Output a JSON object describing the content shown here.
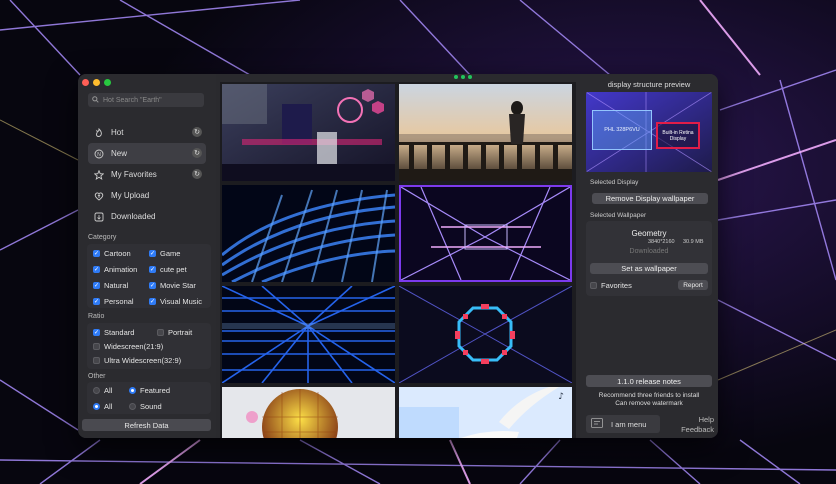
{
  "window": {
    "search": {
      "placeholder": "Hot Search \"Earth\"",
      "icon": "search-icon"
    },
    "nav": [
      {
        "label": "Hot",
        "icon": "flame-icon",
        "active": false,
        "has_count": true
      },
      {
        "label": "New",
        "icon": "new-icon",
        "active": true,
        "has_count": true
      },
      {
        "label": "My Favorites",
        "icon": "star-icon",
        "active": false,
        "has_count": true
      },
      {
        "label": "My Upload",
        "icon": "upload-icon",
        "active": false,
        "has_count": false
      },
      {
        "label": "Downloaded",
        "icon": "download-icon",
        "active": false,
        "has_count": false
      }
    ],
    "category": {
      "title": "Category",
      "items": [
        {
          "label": "Cartoon",
          "checked": true
        },
        {
          "label": "Game",
          "checked": true
        },
        {
          "label": "Animation",
          "checked": true
        },
        {
          "label": "cute pet",
          "checked": true
        },
        {
          "label": "Natural",
          "checked": true
        },
        {
          "label": "Movie Star",
          "checked": true
        },
        {
          "label": "Personal",
          "checked": true
        },
        {
          "label": "Visual Music",
          "checked": true
        }
      ]
    },
    "ratio": {
      "title": "Ratio",
      "items": [
        {
          "label": "Standard",
          "checked": true
        },
        {
          "label": "Portrait",
          "checked": false
        },
        {
          "label": "Widescreen(21:9)",
          "checked": false
        },
        {
          "label": "Ultra Widescreen(32:9)",
          "checked": false
        }
      ]
    },
    "other": {
      "title": "Other",
      "row1": [
        {
          "label": "All",
          "selected": false
        },
        {
          "label": "Featured",
          "selected": true
        }
      ],
      "row2": [
        {
          "label": "All",
          "selected": true
        },
        {
          "label": "Sound",
          "selected": false
        }
      ]
    },
    "refresh_label": "Refresh Data",
    "right": {
      "title": "display structure preview",
      "display_a": "PHL 328P6VU",
      "display_b": "Built-in Retina Display",
      "selected_display_label": "Selected Display",
      "remove_label": "Remove Display wallpaper",
      "selected_wallpaper_label": "Selected Wallpaper",
      "wallpaper_name": "Geometry",
      "resolution": "3840*2160",
      "size": "30.9 MB",
      "status": "Downloaded",
      "set_label": "Set as wallpaper",
      "favorites_label": "Favorites",
      "report_label": "Report",
      "release_notes": "1.1.0 release notes",
      "recommend_line1": "Recommend three friends to install",
      "recommend_line2": "Can remove watermark",
      "menu_label": "I am menu",
      "help_label": "Help",
      "feedback_label": "Feedback"
    }
  },
  "colors": {
    "accent": "#2f7bf6",
    "window_bg": "#2a2a2e",
    "selected_border": "#e11d48",
    "pager": "#22c55e"
  }
}
